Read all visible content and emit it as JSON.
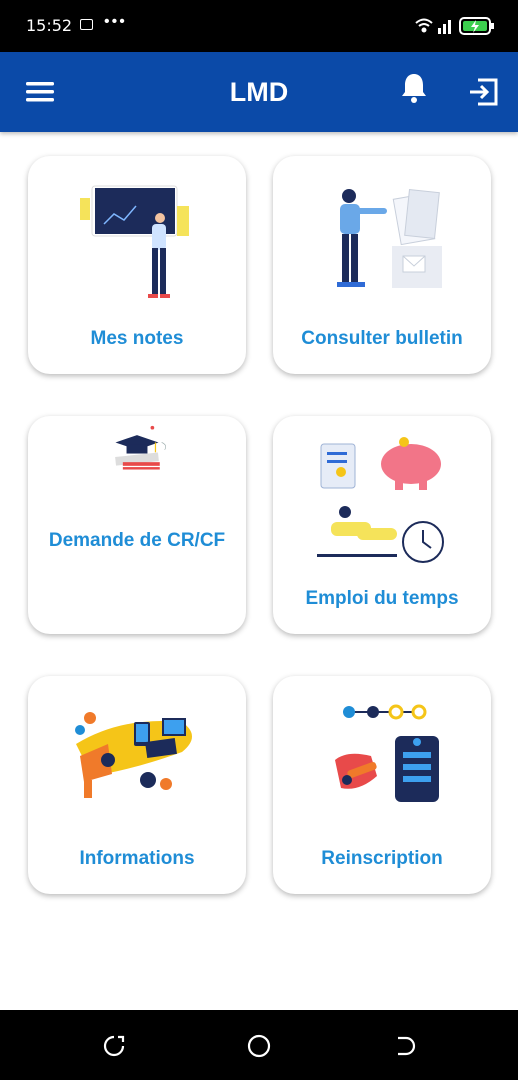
{
  "status_bar": {
    "time": "15:52"
  },
  "app_bar": {
    "title": "LMD"
  },
  "cards": [
    {
      "label": "Mes notes"
    },
    {
      "label": "Consulter bulletin"
    },
    {
      "label": "Demande de CR/CF"
    },
    {
      "label": "Emploi du temps"
    },
    {
      "label": "Informations"
    },
    {
      "label": "Reinscription"
    }
  ],
  "colors": {
    "primary": "#0b4aa8",
    "label": "#1f8dd6",
    "accent_red": "#e84a4a",
    "accent_yellow": "#f5c518"
  },
  "icons": [
    "menu-icon",
    "bell-icon",
    "logout-icon",
    "recent-apps-icon",
    "home-icon",
    "back-icon"
  ]
}
